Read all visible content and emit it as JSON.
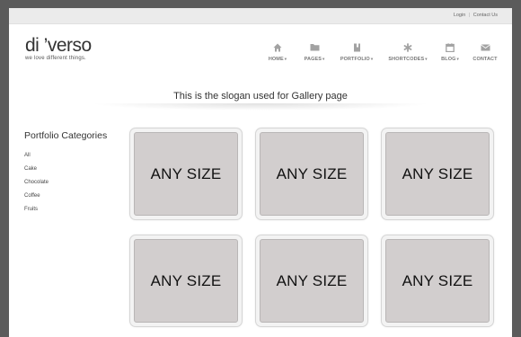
{
  "topbar": {
    "links": [
      "Login",
      "Contact Us"
    ],
    "separator": "|"
  },
  "logo": {
    "title": "di ’verso",
    "tagline": "we love different things."
  },
  "nav": {
    "items": [
      {
        "label": "HOME",
        "icon": "home-icon",
        "dropdown": true
      },
      {
        "label": "PAGES",
        "icon": "folder-icon",
        "dropdown": true
      },
      {
        "label": "PORTFOLIO",
        "icon": "book-icon",
        "dropdown": true
      },
      {
        "label": "SHORTCODES",
        "icon": "asterisk-icon",
        "dropdown": true
      },
      {
        "label": "BLOG",
        "icon": "calendar-icon",
        "dropdown": true
      },
      {
        "label": "CONTACT",
        "icon": "envelope-icon",
        "dropdown": false
      }
    ],
    "caret": "▾"
  },
  "slogan": "This is the slogan used for Gallery page",
  "sidebar": {
    "title": "Portfolio Categories",
    "categories": [
      "All",
      "Cake",
      "Chocolate",
      "Coffee",
      "Fruits"
    ]
  },
  "gallery": {
    "placeholder_text": [
      "ANY SIZE",
      "ANY SIZE",
      "ANY SIZE",
      "ANY SIZE",
      "ANY SIZE",
      "ANY SIZE"
    ]
  },
  "colors": {
    "background": "#5b5b5b",
    "topbar": "#ebebeb",
    "placeholder": "#d2cece"
  }
}
